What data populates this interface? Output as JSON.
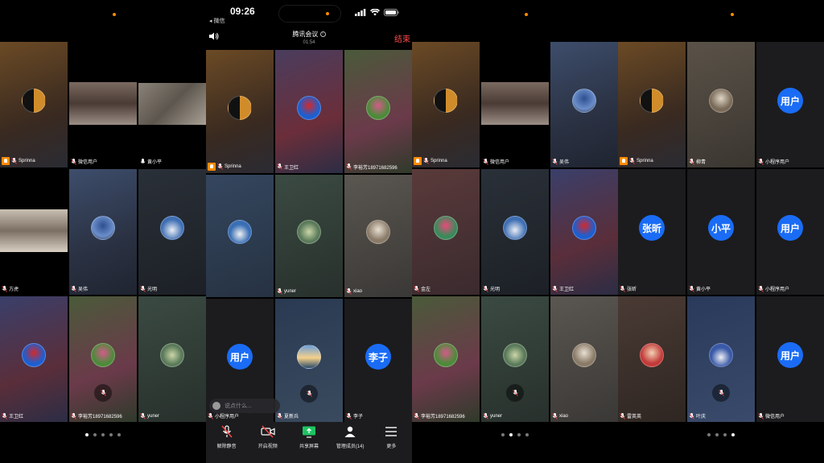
{
  "status": {
    "time": "09:26",
    "back_app": "◂ 微信"
  },
  "meeting": {
    "title": "腾讯会议",
    "timer": "01:54",
    "end_label": "结束",
    "chat_placeholder": "说点什么..."
  },
  "toolbar": [
    {
      "label": "解除静音",
      "icon": "mic-off-icon"
    },
    {
      "label": "开启视频",
      "icon": "camera-off-icon"
    },
    {
      "label": "共享屏幕",
      "icon": "share-screen-icon"
    },
    {
      "label": "管理成员(14)",
      "icon": "members-icon"
    },
    {
      "label": "更多",
      "icon": "more-icon"
    }
  ],
  "colors": {
    "accent_blue": "#1a6cf5",
    "end_red": "#ff4a4a",
    "host_orange": "#ff8a00",
    "active_green": "#1ec462"
  },
  "panels": [
    {
      "tiles": [
        {
          "name": "Sprinna",
          "host": true,
          "kind": "avatar",
          "bg": "linear-gradient(160deg,#6b4a25,#3a2a20 60%,#2a2b33)",
          "av": "linear-gradient(90deg,#111 50%,#d08c2a 50%)"
        },
        {
          "name": "微信用户",
          "kind": "video",
          "bg": "#000",
          "vid": "linear-gradient(180deg,#7a6a60,#4a3b35 50%,#9c8f86)"
        },
        {
          "name": "黄小平",
          "kind": "bigvideo",
          "active": true,
          "mic_active": true,
          "bg": "#000",
          "vid": "linear-gradient(135deg,#8a8378,#5d564e 50%,#a9a196)"
        },
        {
          "name": "方虎",
          "kind": "video",
          "bg": "#000",
          "vid": "linear-gradient(180deg,#c9c0b2,#7b6f63 50%,#d8cfc2)"
        },
        {
          "name": "吴伟",
          "kind": "avatar",
          "bg": "linear-gradient(160deg,#3d4d6b,#2a3142 60%,#1f2430)",
          "av": "radial-gradient(circle at 50% 40%,#2f4e8f,#6b8fcb 60%,#2a3142)"
        },
        {
          "name": "光明",
          "kind": "avatar",
          "bg": "linear-gradient(160deg,#2a3038,#1c2026)",
          "av": "radial-gradient(circle at 50% 60%,#eaeef5,#3f6fb3 60%)"
        },
        {
          "name": "王卫红",
          "kind": "avatar",
          "bg": "linear-gradient(160deg,#3a3f6a,#5a2e3a 60%,#2b2d45)",
          "av": "radial-gradient(circle at 50% 40%,#d22a2a,#1c5fd1 60%)"
        },
        {
          "name": "李裕芳18971682596",
          "kind": "avatar",
          "mute_mid": true,
          "bg": "linear-gradient(160deg,#4a5a3a,#6b3a4a 60%,#2e3a2a)",
          "av": "radial-gradient(circle at 50% 40%,#d35b8a,#4d8a3a 60%)"
        },
        {
          "name": "yuner",
          "kind": "avatar",
          "bg": "linear-gradient(160deg,#3a4a42,#28302c)",
          "av": "radial-gradient(circle at 50% 50%,#cbd6a8,#5a7a5a 60%)"
        }
      ]
    },
    {
      "tiles": [
        {
          "name": "Sprinna",
          "host": true,
          "kind": "avatar",
          "bg": "linear-gradient(160deg,#6b4a25,#3a2a20 60%,#2a2b33)",
          "av": "linear-gradient(90deg,#111 50%,#d08c2a 50%)"
        },
        {
          "name": "王卫红",
          "kind": "avatar",
          "bg": "linear-gradient(160deg,#4a3d5e,#6b2e3a 60%,#2b2d45)",
          "av": "radial-gradient(circle at 50% 40%,#d22a2a,#1c5fd1 60%)"
        },
        {
          "name": "李裕芳18971682596",
          "kind": "avatar",
          "bg": "linear-gradient(160deg,#4a5a3a,#6b3a4a 60%,#2e3a2a)",
          "av": "radial-gradient(circle at 50% 40%,#d35b8a,#4d8a3a 60%)"
        },
        {
          "name": "",
          "kind": "avatar",
          "bg": "linear-gradient(160deg,#34465e,#263242)",
          "av": "radial-gradient(circle at 50% 60%,#f2f2f2,#3a6fb5 55%)"
        },
        {
          "name": "yuner",
          "kind": "avatar",
          "bg": "linear-gradient(160deg,#3a4a42,#28302c)",
          "av": "radial-gradient(circle at 50% 50%,#cbd6a8,#5a7a5a 60%)"
        },
        {
          "name": "xiao",
          "kind": "avatar",
          "bg": "linear-gradient(160deg,#5a5650,#3a3836)",
          "av": "radial-gradient(circle at 50% 40%,#e8e0d2,#8a7a68 60%)"
        },
        {
          "name": "小程序用户",
          "kind": "text",
          "text": "用户",
          "bg": "#1c1c1e"
        },
        {
          "name": "夏新兵",
          "kind": "avatar",
          "mute_mid": true,
          "bg": "linear-gradient(160deg,#2a3a52,#3a4a5e)",
          "av": "linear-gradient(180deg,#6ea0d8,#f4d08a 55%,#2a4a6a)"
        },
        {
          "name": "李子",
          "kind": "text",
          "text": "李子",
          "bg": "#1c1c1e"
        }
      ]
    },
    {
      "tiles": [
        {
          "name": "Sprinna",
          "host": true,
          "kind": "avatar",
          "bg": "linear-gradient(160deg,#6b4a25,#3a2a20 60%,#2a2b33)",
          "av": "linear-gradient(90deg,#111 50%,#d08c2a 50%)"
        },
        {
          "name": "微信用户",
          "kind": "video",
          "bg": "#000",
          "vid": "linear-gradient(180deg,#7a6a60,#4a3b35 50%,#9c8f86)"
        },
        {
          "name": "吴伟",
          "kind": "avatar",
          "bg": "linear-gradient(160deg,#3d4d6b,#2a3142 60%,#1f2430)",
          "av": "radial-gradient(circle at 50% 40%,#2f4e8f,#6b8fcb 60%,#2a3142)"
        },
        {
          "name": "金左",
          "kind": "avatar",
          "bg": "linear-gradient(160deg,#5a3a3a,#3a2a2e)",
          "av": "radial-gradient(circle at 50% 40%,#e84a7a,#3a8a5a 60%)"
        },
        {
          "name": "光明",
          "kind": "avatar",
          "bg": "linear-gradient(160deg,#2a3038,#1c2026)",
          "av": "radial-gradient(circle at 50% 60%,#eaeef5,#3f6fb3 60%)"
        },
        {
          "name": "王卫红",
          "kind": "avatar",
          "bg": "linear-gradient(160deg,#3a3f6a,#5a2e3a 60%,#2b2d45)",
          "av": "radial-gradient(circle at 50% 40%,#d22a2a,#1c5fd1 60%)"
        },
        {
          "name": "李裕芳18971682596",
          "kind": "avatar",
          "bg": "linear-gradient(160deg,#4a5a3a,#6b3a4a 60%,#2e3a2a)",
          "av": "radial-gradient(circle at 50% 40%,#d35b8a,#4d8a3a 60%)"
        },
        {
          "name": "yuner",
          "kind": "avatar",
          "mute_mid": true,
          "bg": "linear-gradient(160deg,#3a4a42,#28302c)",
          "av": "radial-gradient(circle at 50% 50%,#cbd6a8,#5a7a5a 60%)"
        },
        {
          "name": "xiao",
          "kind": "avatar",
          "bg": "linear-gradient(160deg,#5a5650,#3a3836)",
          "av": "radial-gradient(circle at 50% 40%,#e8e0d2,#8a7a68 60%)"
        }
      ]
    },
    {
      "tiles": [
        {
          "name": "Sprinna",
          "host": true,
          "kind": "avatar",
          "bg": "linear-gradient(160deg,#6b4a25,#3a2a20 60%,#2a2b33)",
          "av": "linear-gradient(90deg,#111 50%,#d08c2a 50%)"
        },
        {
          "name": "柳青",
          "kind": "avatar",
          "bg": "linear-gradient(160deg,#5a5248,#3a3630)",
          "av": "radial-gradient(circle at 50% 40%,#e0d6c6,#7a6a58 60%)"
        },
        {
          "name": "小程序用户",
          "kind": "text",
          "text": "用户",
          "bg": "#1c1c1e"
        },
        {
          "name": "张昕",
          "kind": "text",
          "text": "张昕",
          "bg": "#1c1c1e"
        },
        {
          "name": "黄小平",
          "kind": "text",
          "text": "小平",
          "bg": "#1c1c1e"
        },
        {
          "name": "小程序用户",
          "kind": "text",
          "text": "用户",
          "bg": "#1c1c1e"
        },
        {
          "name": "雷英英",
          "kind": "avatar",
          "bg": "linear-gradient(160deg,#4a3a34,#2e2622)",
          "av": "radial-gradient(circle at 50% 40%,#f2d2b2,#c23a3a 60%)"
        },
        {
          "name": "叶庆",
          "kind": "avatar",
          "mute_mid": true,
          "bg": "linear-gradient(160deg,#2a3a5a,#3a4a6a)",
          "av": "radial-gradient(circle at 50% 60%,#f0f0f4,#3a5aa8 55%)"
        },
        {
          "name": "微信用户",
          "kind": "text",
          "text": "用户",
          "bg": "#1c1c1e"
        }
      ]
    }
  ],
  "page_dots": [
    {
      "count": 5,
      "active": 0
    },
    {
      "count": 4,
      "active": 1
    },
    {
      "count": 4,
      "active": 3
    }
  ]
}
